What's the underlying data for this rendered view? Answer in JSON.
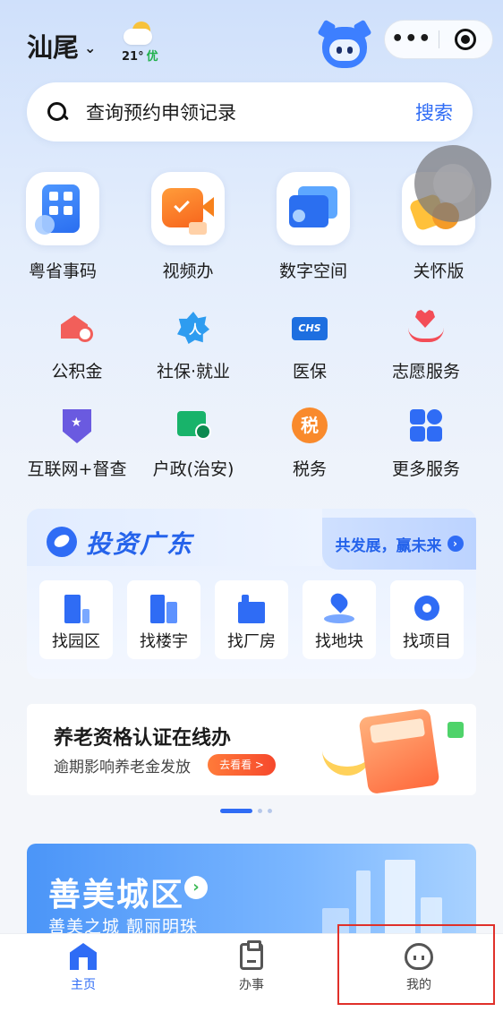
{
  "header": {
    "city": "汕尾",
    "temperature": "21°",
    "air_quality": "优",
    "more_glyph": "•••"
  },
  "search": {
    "placeholder": "查询预约申领记录",
    "button": "搜索"
  },
  "featured": [
    {
      "label": "粤省事码",
      "icon": "qr-code-icon"
    },
    {
      "label": "视频办",
      "icon": "video-camera-icon"
    },
    {
      "label": "数字空间",
      "icon": "digital-space-icon"
    },
    {
      "label": "关怀版",
      "icon": "care-icon"
    }
  ],
  "services": [
    {
      "label": "公积金",
      "icon": "housing-fund-icon"
    },
    {
      "label": "社保·就业",
      "icon": "social-security-icon"
    },
    {
      "label": "医保",
      "icon": "medical-insurance-icon",
      "badge": "CHS"
    },
    {
      "label": "志愿服务",
      "icon": "volunteer-icon"
    },
    {
      "label": "互联网+督查",
      "icon": "supervision-icon"
    },
    {
      "label": "户政(治安)",
      "icon": "household-icon"
    },
    {
      "label": "税务",
      "icon": "tax-icon",
      "badge": "税"
    },
    {
      "label": "更多服务",
      "icon": "more-services-icon"
    }
  ],
  "invest": {
    "title": "投资广东",
    "slogan": "共发展，赢未来",
    "items": [
      "找园区",
      "找楼宇",
      "找厂房",
      "找地块",
      "找项目"
    ]
  },
  "pension": {
    "title": "养老资格认证在线办",
    "subtitle": "逾期影响养老金发放",
    "button": "去看看 >"
  },
  "carousel": {
    "count": 3,
    "active_index": 0
  },
  "city_banner": {
    "title": "善美城区",
    "subtitle": "善美之城 靓丽明珠"
  },
  "tabbar": [
    {
      "label": "主页",
      "active": true
    },
    {
      "label": "办事",
      "active": false
    },
    {
      "label": "我的",
      "active": false
    }
  ],
  "colors": {
    "accent": "#2f6cf5",
    "highlight_box": "#e0302a"
  }
}
